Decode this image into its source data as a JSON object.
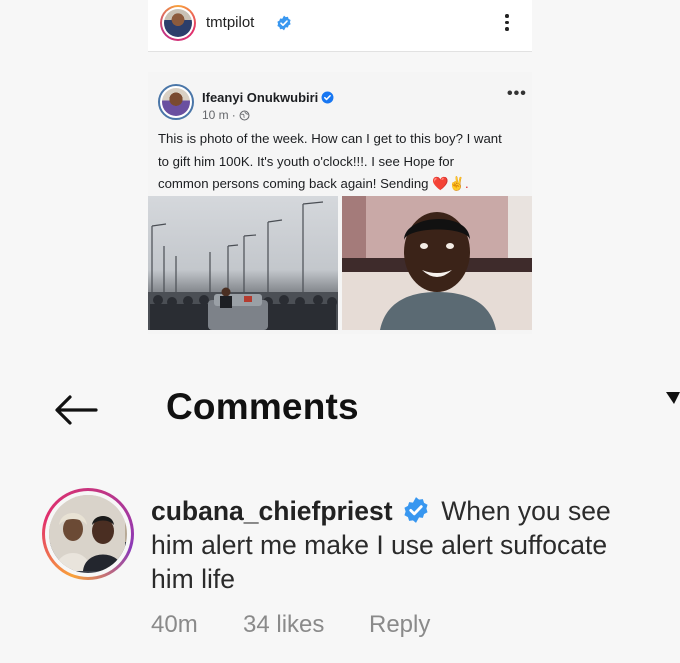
{
  "post_header": {
    "username": "tmtpilot",
    "avatar_icon": "profile-photo",
    "verified_icon": "verified-badge-icon",
    "more_icon": "vertical-dots-icon"
  },
  "fb_post": {
    "author": "Ifeanyi Onukwubiri",
    "time": "10 m",
    "separator": "·",
    "lines": [
      "This is photo of the week. How can I get to this boy? I want",
      "to gift him 100K. It's youth o'clock!!!. I see Hope for",
      "common persons coming back again! Sending"
    ],
    "emoji_tail": "❤️✌️.",
    "more_icon": "horizontal-dots-icon"
  },
  "comments": {
    "title": "Comments",
    "back_icon": "arrow-left-icon",
    "comment": {
      "username": "cubana_chiefpriest",
      "text_first": "When you see",
      "text_line2": "him alert me make I use alert suffocate",
      "text_line3": "him life",
      "time": "40m",
      "likes": "34 likes",
      "reply": "Reply"
    }
  },
  "colors": {
    "verified": "#3897f0",
    "fb_verified": "#1877f2",
    "story_ring_start": "#f9a23a",
    "story_ring_end": "#c13584",
    "meta_text": "#8a8a8a"
  }
}
